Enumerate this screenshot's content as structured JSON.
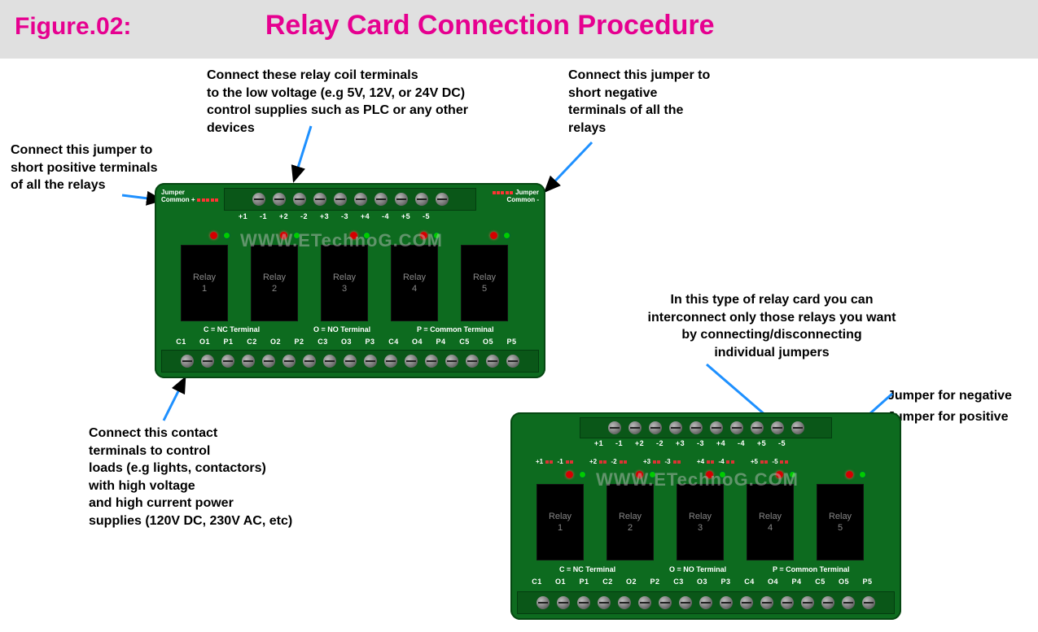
{
  "header": {
    "fig": "Figure.02:",
    "title": "Relay Card Connection Procedure"
  },
  "ann": {
    "coil": "Connect these relay coil terminals\nto the low voltage (e.g 5V, 12V, or 24V DC)\ncontrol supplies such as PLC or any other devices",
    "jpos": "Connect this jumper to\nshort positive terminals\nof all the relays",
    "jneg": "Connect this jumper to\nshort negative\nterminals of all the\nrelays",
    "contacts": "Connect this contact\nterminals to control\nloads (e.g lights, contactors)\nwith high voltage\nand high current power\nsupplies (120V DC, 230V AC, etc)",
    "type2": "In this type of relay card you can\ninterconnect only those relays you want\nby connecting/disconnecting\nindividual jumpers",
    "jn": "Jumper for negative",
    "jp": "Jumper for positive"
  },
  "card": {
    "jumperPosLabel": "Jumper\nCommon +",
    "jumperNegLabel": "Jumper\nCommon -",
    "coilLabels": [
      "+1",
      "-1",
      "+2",
      "-2",
      "+3",
      "-3",
      "+4",
      "-4",
      "+5",
      "-5"
    ],
    "legendC": "C = NC Terminal",
    "legendO": "O = NO Terminal",
    "legendP": "P = Common Terminal",
    "bottomLabels": [
      "C1",
      "O1",
      "P1",
      "C2",
      "O2",
      "P2",
      "C3",
      "O3",
      "P3",
      "C4",
      "O4",
      "P4",
      "C5",
      "O5",
      "P5"
    ],
    "relays": [
      "Relay\n1",
      "Relay\n2",
      "Relay\n3",
      "Relay\n4",
      "Relay\n5"
    ]
  },
  "watermark": "WWW.ETechnoG.COM"
}
